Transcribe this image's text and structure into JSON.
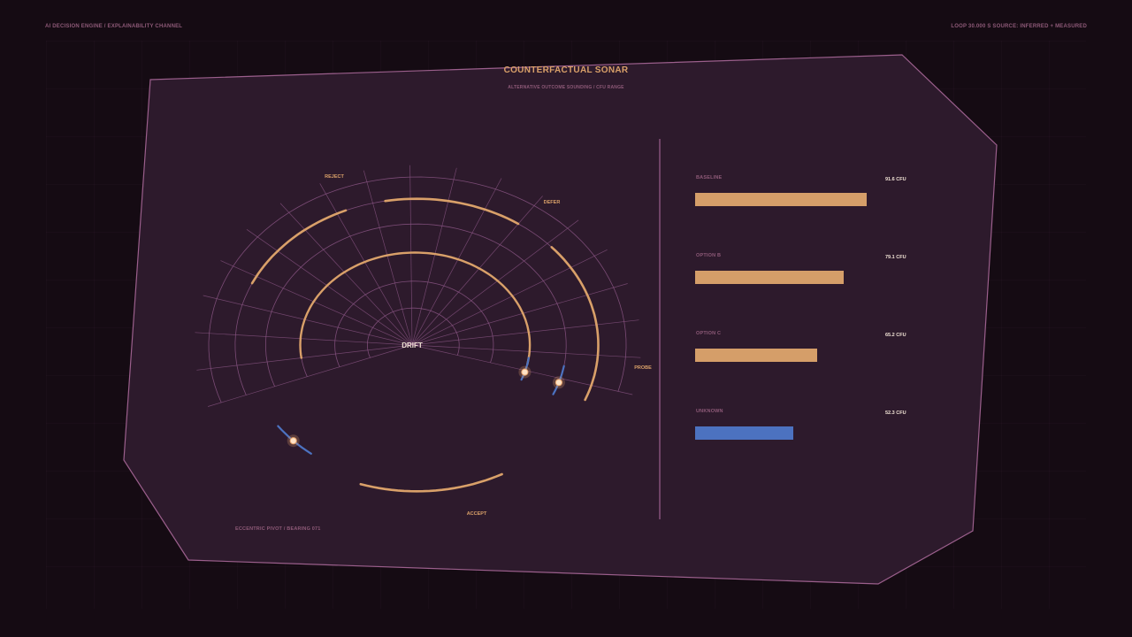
{
  "header": {
    "left": "AI DECISION ENGINE / EXPLAINABILITY CHANNEL",
    "right": "LOOP 30.000 S   SOURCE: INFERRED + MEASURED"
  },
  "panel": {
    "title": "COUNTERFACTUAL SONAR",
    "subtitle": "ALTERNATIVE OUTCOME SOUNDING / CFU RANGE",
    "footer": "ECCENTRIC PIVOT / BEARING 071"
  },
  "sonar": {
    "center_label": "DRIFT",
    "bearing_labels": [
      "REJECT",
      "DEFER",
      "PROBE",
      "ACCEPT"
    ]
  },
  "bars": {
    "max": 100,
    "items": [
      {
        "label": "BASELINE",
        "value": 91.6,
        "value_text": "91.6 CFU",
        "color": "#d59e69"
      },
      {
        "label": "OPTION B",
        "value": 79.1,
        "value_text": "79.1 CFU",
        "color": "#d59e69"
      },
      {
        "label": "OPTION C",
        "value": 65.2,
        "value_text": "65.2 CFU",
        "color": "#d59e69"
      },
      {
        "label": "UNKNOWN",
        "value": 52.3,
        "value_text": "52.3 CFU",
        "color": "#4c72c0"
      }
    ]
  },
  "colors": {
    "background": "#150b13",
    "panel_fill": "#2d1a2c",
    "panel_stroke": "#9b5f8c",
    "accent_orange": "#d9a069",
    "accent_blue": "#4c72c0",
    "muted_text": "#8e5a78"
  }
}
